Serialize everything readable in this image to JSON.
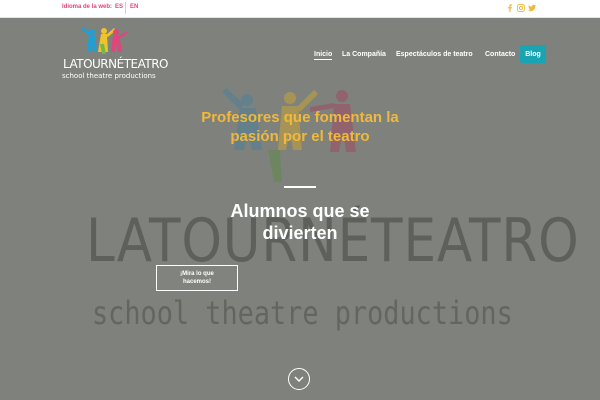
{
  "topbar": {
    "language_label": "Idioma de la web:",
    "lang_es": "ES",
    "lang_en": "EN",
    "social_icons": [
      "facebook-icon",
      "instagram-icon",
      "twitter-icon"
    ],
    "social_color": "#f0b93b"
  },
  "header": {
    "logo_text": "LATOURNÉTEATRO",
    "logo_subtitle": "school theatre productions",
    "nav": [
      {
        "label": "Inicio",
        "active": true
      },
      {
        "label": "La Compañía",
        "active": false
      },
      {
        "label": "Espectáculos de teatro",
        "active": false
      },
      {
        "label": "Contacto",
        "active": false
      }
    ],
    "blog_label": "Blog",
    "blog_color": "#19a4b3"
  },
  "hero": {
    "title": "Profesores que fomentan la pasión por el teatro",
    "title_color": "#f0b93b",
    "subtitle": "Alumnos que se divierten",
    "cta_label": "¡Mira lo que hacemos!",
    "background_logo_text": "LATOURNÉTEATRO",
    "background_logo_subtitle": "school theatre productions",
    "scroll_icon": "chevron-down-icon"
  }
}
